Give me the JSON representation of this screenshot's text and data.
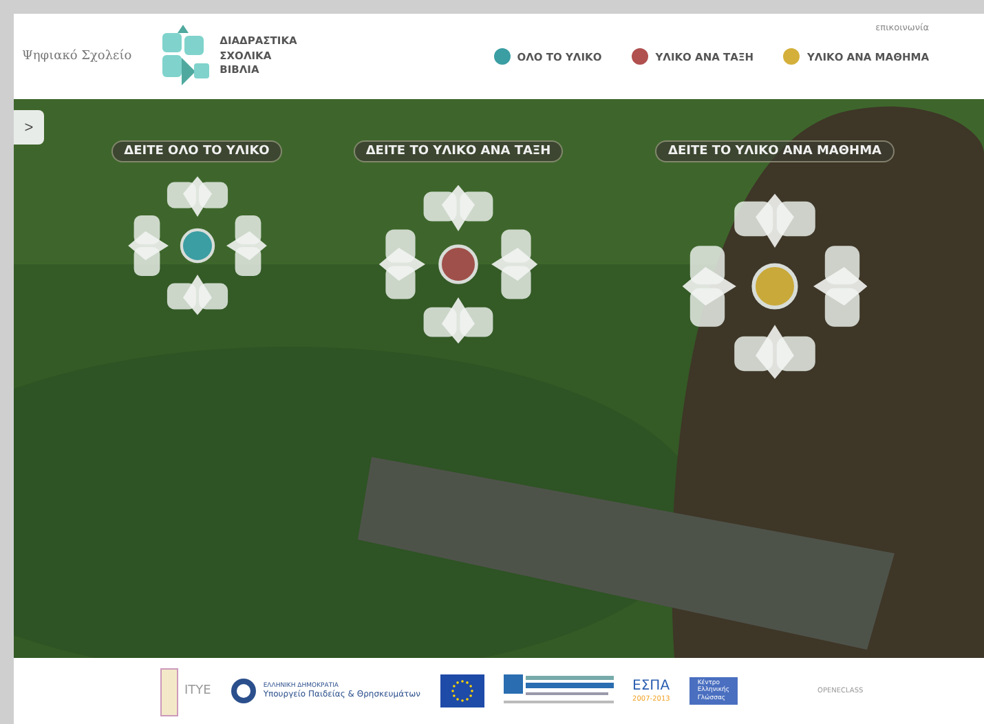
{
  "header": {
    "logo_text": "Ψηφιακό Σχολείο",
    "title_lines": [
      "ΔΙΑΔΡΑΣΤΙΚΑ",
      "ΣΧΟΛΙΚΑ",
      "ΒΙΒΛΙΑ"
    ],
    "contact_link": "επικοινωνία",
    "nav": [
      {
        "label": "ΟΛΟ ΤΟ ΥΛΙΚΟ",
        "color": "#3a9ea3"
      },
      {
        "label": "ΥΛΙΚΟ ΑΝΑ ΤΑΞΗ",
        "color": "#b0504f"
      },
      {
        "label": "ΥΛΙΚΟ ΑΝΑ ΜΑΘΗΜΑ",
        "color": "#d4b03b"
      }
    ]
  },
  "side_toggle": ">",
  "sections": [
    {
      "label": "ΔΕΙΤΕ ΟΛΟ ΤΟ ΥΛΙΚΟ",
      "color": "#3a9ea3"
    },
    {
      "label": "ΔΕΙΤΕ ΤΟ ΥΛΙΚΟ ΑΝΑ ΤΑΞΗ",
      "color": "#a0504a"
    },
    {
      "label": "ΔΕΙΤΕ ΤΟ ΥΛΙΚΟ ΑΝΑ ΜΑΘΗΜΑ",
      "color": "#c9a93a"
    }
  ],
  "footer": {
    "logos": [
      {
        "kind": "itye",
        "lines": [
          "ΙΤΥΕ"
        ]
      },
      {
        "kind": "ministry",
        "lines": [
          "ΕΛΛΗΝΙΚΗ ΔΗΜΟΚΡΑΤΙΑ",
          "Υπουργείο Παιδείας & Θρησκευμάτων"
        ]
      },
      {
        "kind": "eu"
      },
      {
        "kind": "programme"
      },
      {
        "kind": "espa",
        "lines": [
          "ΕΣΠΑ",
          "2007-2013"
        ]
      },
      {
        "kind": "kee",
        "lines": [
          "Κέντρο",
          "Ελληνικής",
          "Γλώσσας"
        ]
      },
      {
        "kind": "eclass",
        "lines": [
          "OPENECLASS"
        ]
      }
    ]
  }
}
